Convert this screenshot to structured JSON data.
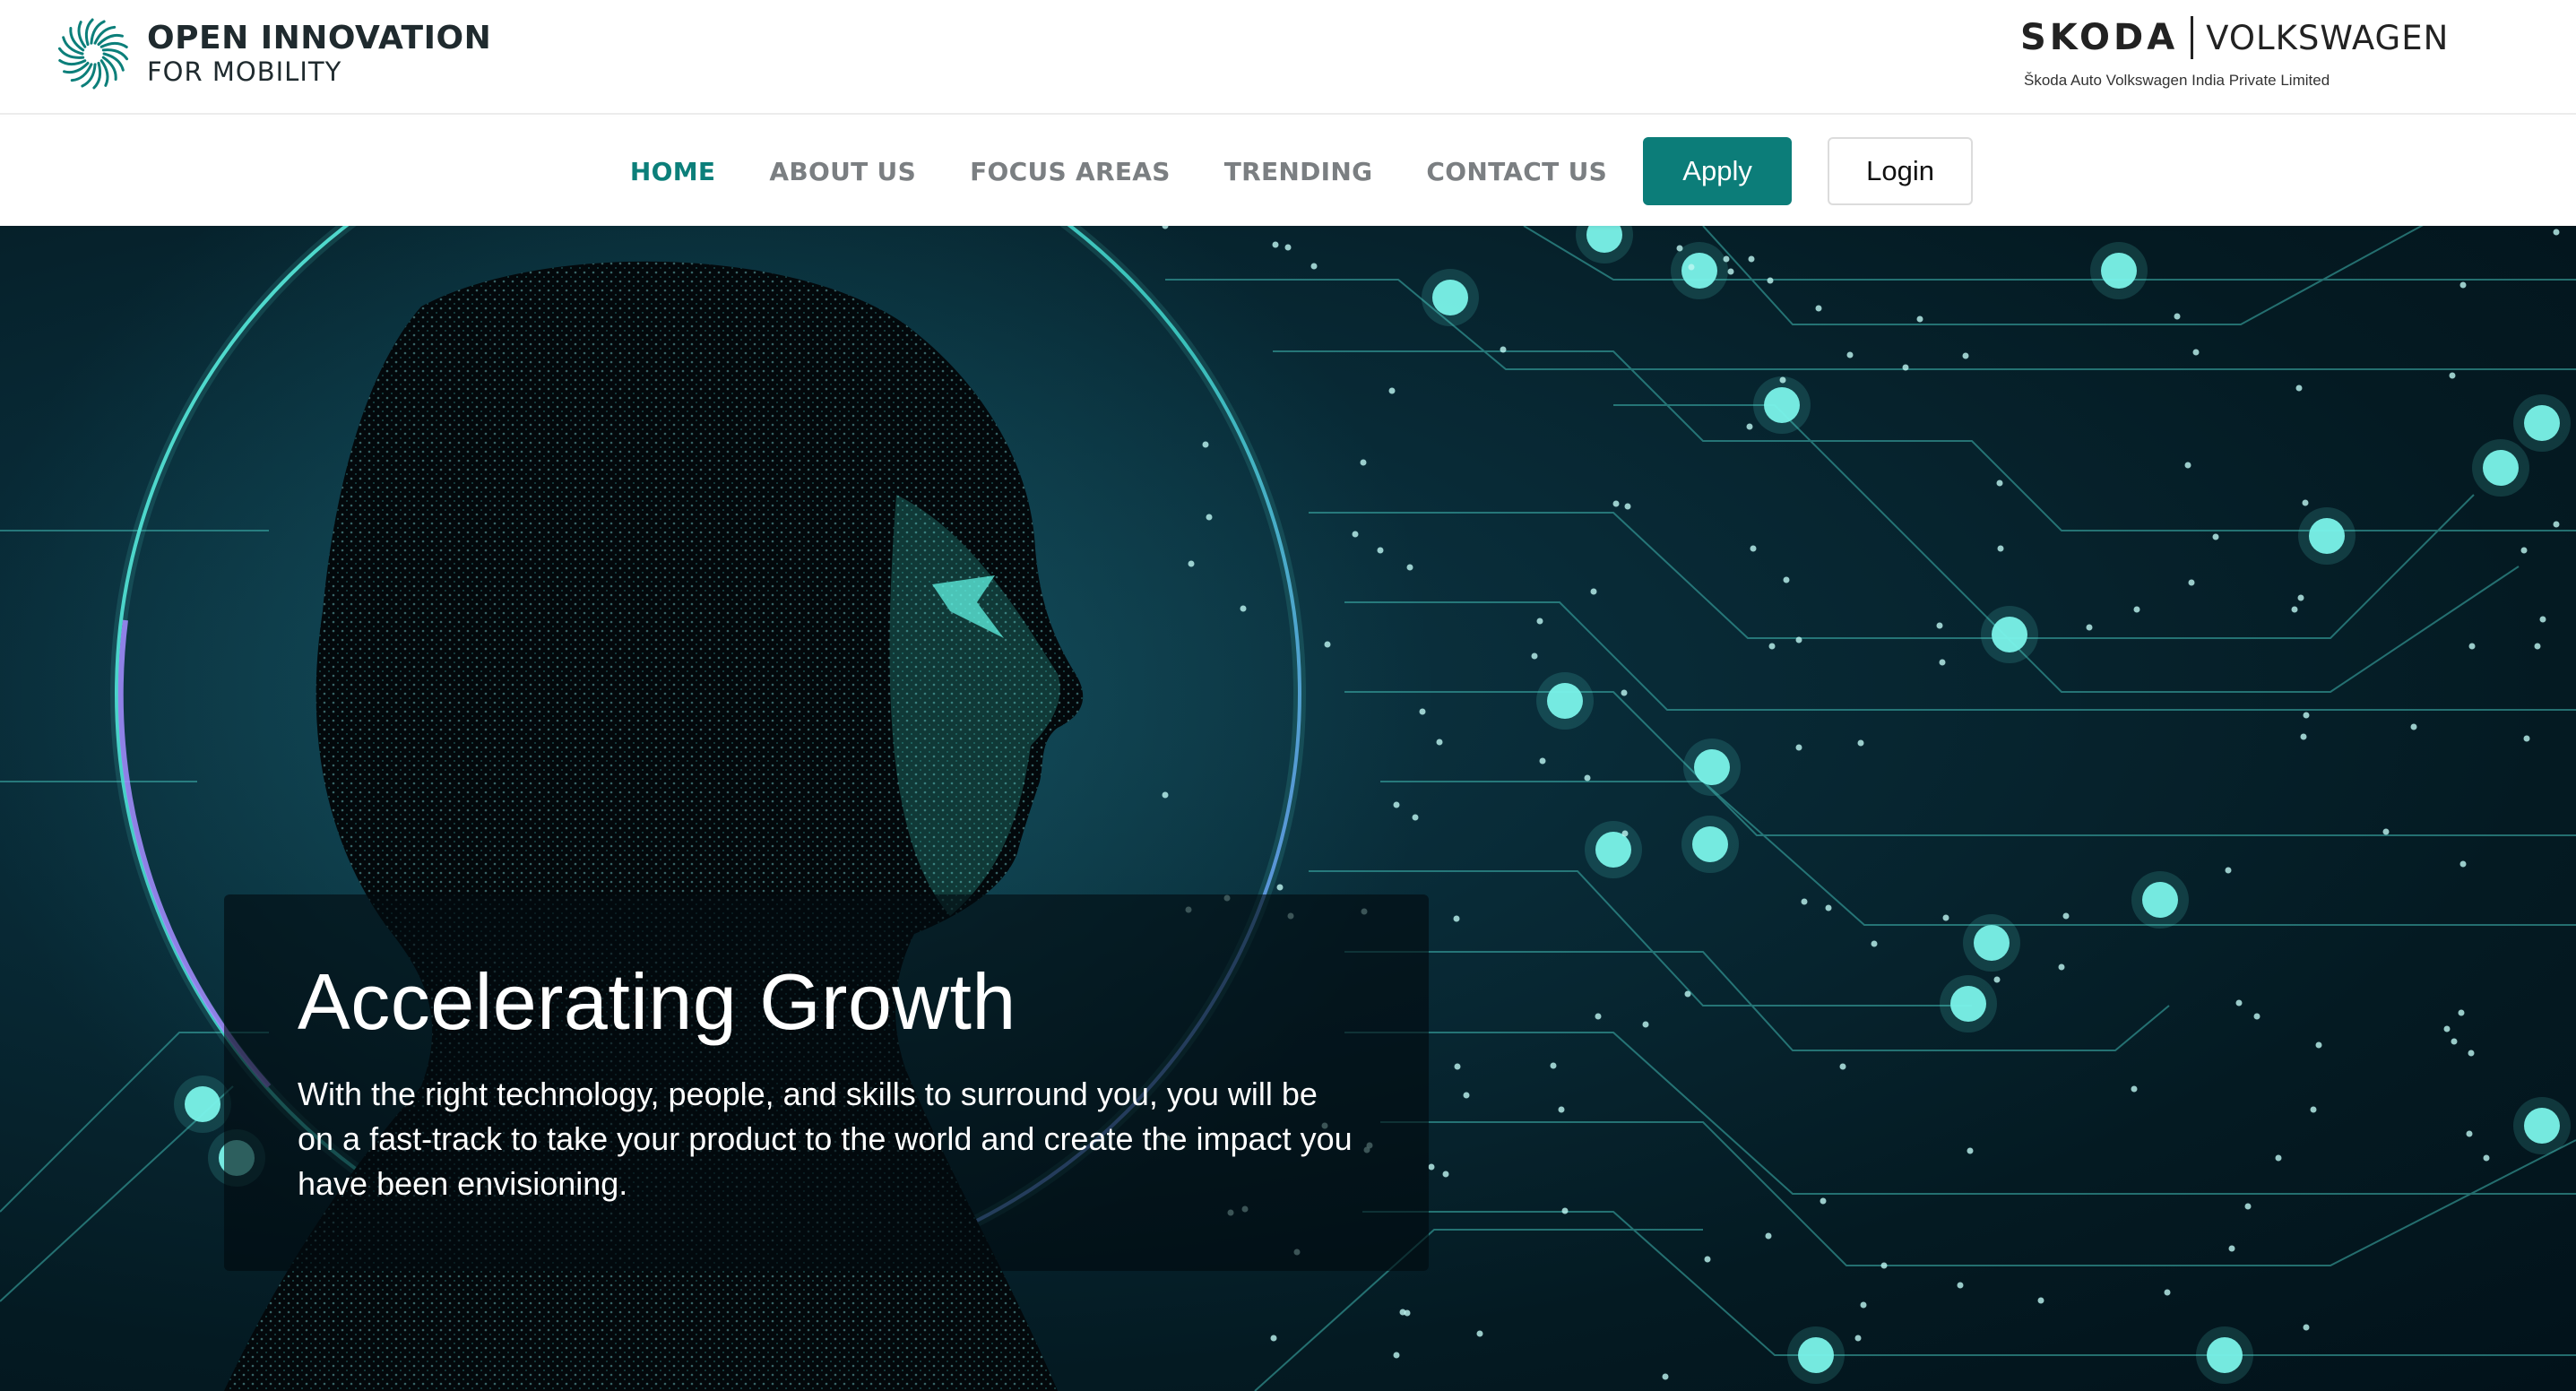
{
  "brand": {
    "name_line1": "OPEN INNOVATION",
    "name_line2": "FOR MOBILITY",
    "logo_icon": "sunburst-swirl-icon",
    "brand_color": "#0c7f7a"
  },
  "partner": {
    "skoda": "SKODA",
    "volkswagen": "VOLKSWAGEN",
    "subtitle": "Škoda Auto Volkswagen India Private Limited"
  },
  "nav": {
    "items": [
      {
        "label": "HOME",
        "active": true
      },
      {
        "label": "ABOUT US",
        "active": false
      },
      {
        "label": "FOCUS AREAS",
        "active": false
      },
      {
        "label": "TRENDING",
        "active": false
      },
      {
        "label": "CONTACT US",
        "active": false
      }
    ],
    "apply_label": "Apply",
    "login_label": "Login",
    "active_color": "#0c7f7a",
    "inactive_color": "#7b7f82"
  },
  "hero": {
    "title": "Accelerating Growth",
    "description": "With the right technology, people, and skills to surround you, you will be on a fast-track to take your product to the world and create the impact you have been envisioning.",
    "background_icon": "digital-human-head-circuit-illustration",
    "accent_color": "#4ee6d8"
  }
}
